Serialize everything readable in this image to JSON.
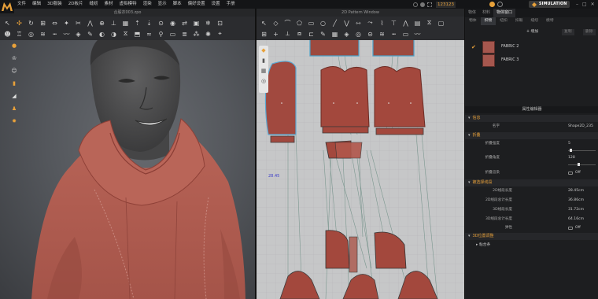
{
  "menubar": {
    "items": [
      "文件",
      "编辑",
      "3D服装",
      "2D板片",
      "缝纫",
      "素材",
      "虚拟模特",
      "渲染",
      "显示",
      "脚本",
      "偏好设置",
      "设置",
      "手册"
    ],
    "user_id": "123123",
    "simulation_label": "SIMULATION"
  },
  "view3d": {
    "title": "合股衣003.zpo",
    "toolbar_icons": [
      "select-icon",
      "move-icon",
      "rotate-icon",
      "transform-icon",
      "stretch-icon",
      "pin-icon",
      "sew-icon",
      "fold-icon",
      "avatar-icon",
      "arrange-icon",
      "fit-icon",
      "measure-icon",
      "texture-icon",
      "lock-icon",
      "freeze-icon",
      "sync-icon",
      "push-icon",
      "pull-icon",
      "zoom-icon",
      "camera-icon"
    ],
    "side_icons": [
      "avatar-toggle-icon",
      "garment-toggle-icon",
      "skin-icon",
      "texture-icon",
      "pattern-icon",
      "render-icon",
      "sun-icon"
    ]
  },
  "view2d": {
    "title": "2D Pattern Window",
    "dimension_label": "28.45"
  },
  "right_panel": {
    "tabs": [
      "物体",
      "材料",
      "物体窗口"
    ],
    "panel_title": "物体窗口",
    "object_tabs": [
      "物体",
      "织物",
      "纽扣",
      "扣眼",
      "缝纫",
      "模特"
    ],
    "active_object_tab": 1,
    "add_label": "+ 增加",
    "clone_label": "复制",
    "delete_label": "删除",
    "fabrics": [
      {
        "name": "FABRIC 2",
        "selected": true,
        "color": "#a6574e"
      },
      {
        "name": "FABRIC 3",
        "selected": false,
        "color": "#a6574e"
      }
    ],
    "property_header": "属性编辑器",
    "sections": {
      "info": {
        "title": "信息",
        "name_label": "名字",
        "name_value": "Shape2D_235"
      },
      "fold": {
        "title": "折叠",
        "strength_label": "折叠强度",
        "strength_value": "5",
        "strength_level": 0.06,
        "angle_label": "折叠角度",
        "angle_value": "128",
        "angle_level": 0.36,
        "render_label": "折叠渲染",
        "render_value": "Off"
      },
      "seam": {
        "title": "被选择线段",
        "rows": [
          {
            "label": "2D线段长度",
            "value": "28.45cm"
          },
          {
            "label": "2D线段总计长度",
            "value": "36.86cm"
          },
          {
            "label": "3D线段长度",
            "value": "31.72cm"
          },
          {
            "label": "3D线段总计长度",
            "value": "64.16cm"
          },
          {
            "label": "弹性",
            "value": "Off"
          }
        ]
      },
      "position": {
        "title": "3D位置调整",
        "sub_label": "▸ 粘合条"
      }
    }
  }
}
